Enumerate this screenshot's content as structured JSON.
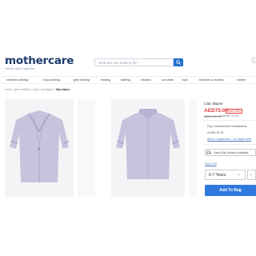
{
  "header": {
    "logo": "mothercare",
    "tagline": "better start together",
    "search_placeholder": "what are you looking for?"
  },
  "nav": {
    "items": [
      "newborn clothing",
      "boys clothing",
      "girls clothing",
      "feeding",
      "bathing",
      "strollers",
      "car seats",
      "toys",
      "bedroom & nursery",
      "mother"
    ]
  },
  "breadcrumb": {
    "items": [
      "home",
      "girls clothing",
      "tops",
      "cardigans"
    ],
    "current": "lilac blazer"
  },
  "product": {
    "name": "Lilac Blazer",
    "price": "AED75.00",
    "save_badge": "Save 50%",
    "was_price": "AED 150.00",
    "vat_note": "Inclusive of VAT",
    "payment_line1": "Pay 4 interest-free installments",
    "payment_line2": "of AED 18.75",
    "payment_link": "Split in 4 payments – No hidden fees",
    "delivery_label": "Same Day Delivery Available",
    "size_guide": "Size & Fit",
    "selected_size": "6-7 Years",
    "add_to_bag": "Add To Bag"
  },
  "colors": {
    "brand": "#1b3a6b",
    "accent": "#2f78dd",
    "price": "#e23b3b",
    "garment": "#c8c2dc"
  }
}
